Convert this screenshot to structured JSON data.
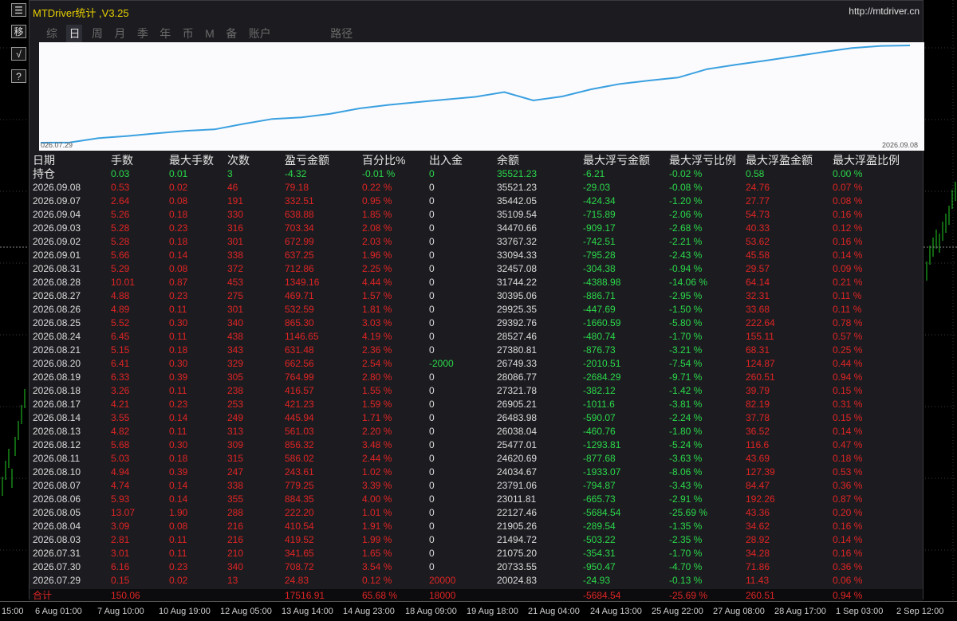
{
  "app": {
    "title": "MTDriver统计 ,V3.25",
    "url": "http://mtdriver.cn",
    "tabs": [
      "综",
      "日",
      "周",
      "月",
      "季",
      "年",
      "币",
      "M",
      "备",
      "账户",
      "路径"
    ],
    "active_tab": "日"
  },
  "side_buttons": [
    "☰",
    "移",
    "√",
    "?"
  ],
  "equity_chart": {
    "start_label": "026.07.29",
    "end_label": "2026.09.08",
    "line_color": "#3aa0e0"
  },
  "table": {
    "headers": [
      "日期",
      "手数",
      "最大手数",
      "次数",
      "盈亏金额",
      "百分比%",
      "出入金",
      "余额",
      "最大浮亏金额",
      "最大浮亏比例",
      "最大浮盈金额",
      "最大浮盈比例"
    ],
    "position_row": [
      "持仓",
      "0.03",
      "0.01",
      "3",
      "-4.32",
      "-0.01 %",
      "0",
      "35521.23",
      "-6.21",
      "-0.02 %",
      "0.58",
      "0.00 %"
    ],
    "rows": [
      [
        "2026.09.08",
        "0.53",
        "0.02",
        "46",
        "79.18",
        "0.22 %",
        "0",
        "35521.23",
        "-29.03",
        "-0.08 %",
        "24.76",
        "0.07 %"
      ],
      [
        "2026.09.07",
        "2.64",
        "0.08",
        "191",
        "332.51",
        "0.95 %",
        "0",
        "35442.05",
        "-424.34",
        "-1.20 %",
        "27.77",
        "0.08 %"
      ],
      [
        "2026.09.04",
        "5.26",
        "0.18",
        "330",
        "638.88",
        "1.85 %",
        "0",
        "35109.54",
        "-715.89",
        "-2.06 %",
        "54.73",
        "0.16 %"
      ],
      [
        "2026.09.03",
        "5.28",
        "0.23",
        "316",
        "703.34",
        "2.08 %",
        "0",
        "34470.66",
        "-909.17",
        "-2.68 %",
        "40.33",
        "0.12 %"
      ],
      [
        "2026.09.02",
        "5.28",
        "0.18",
        "301",
        "672.99",
        "2.03 %",
        "0",
        "33767.32",
        "-742.51",
        "-2.21 %",
        "53.62",
        "0.16 %"
      ],
      [
        "2026.09.01",
        "5.66",
        "0.14",
        "338",
        "637.25",
        "1.96 %",
        "0",
        "33094.33",
        "-795.28",
        "-2.43 %",
        "45.58",
        "0.14 %"
      ],
      [
        "2026.08.31",
        "5.29",
        "0.08",
        "372",
        "712.86",
        "2.25 %",
        "0",
        "32457.08",
        "-304.38",
        "-0.94 %",
        "29.57",
        "0.09 %"
      ],
      [
        "2026.08.28",
        "10.01",
        "0.87",
        "453",
        "1349.16",
        "4.44 %",
        "0",
        "31744.22",
        "-4388.98",
        "-14.06 %",
        "64.14",
        "0.21 %"
      ],
      [
        "2026.08.27",
        "4.88",
        "0.23",
        "275",
        "469.71",
        "1.57 %",
        "0",
        "30395.06",
        "-886.71",
        "-2.95 %",
        "32.31",
        "0.11 %"
      ],
      [
        "2026.08.26",
        "4.89",
        "0.11",
        "301",
        "532.59",
        "1.81 %",
        "0",
        "29925.35",
        "-447.69",
        "-1.50 %",
        "33.68",
        "0.11 %"
      ],
      [
        "2026.08.25",
        "5.52",
        "0.30",
        "340",
        "865.30",
        "3.03 %",
        "0",
        "29392.76",
        "-1660.59",
        "-5.80 %",
        "222.64",
        "0.78 %"
      ],
      [
        "2026.08.24",
        "6.45",
        "0.11",
        "438",
        "1146.65",
        "4.19 %",
        "0",
        "28527.46",
        "-480.74",
        "-1.70 %",
        "155.11",
        "0.57 %"
      ],
      [
        "2026.08.21",
        "5.15",
        "0.18",
        "343",
        "631.48",
        "2.36 %",
        "0",
        "27380.81",
        "-876.73",
        "-3.21 %",
        "68.31",
        "0.25 %"
      ],
      [
        "2026.08.20",
        "6.41",
        "0.30",
        "329",
        "662.56",
        "2.54 %",
        "-2000",
        "26749.33",
        "-2010.51",
        "-7.54 %",
        "124.87",
        "0.44 %"
      ],
      [
        "2026.08.19",
        "6.33",
        "0.39",
        "305",
        "764.99",
        "2.80 %",
        "0",
        "28086.77",
        "-2684.29",
        "-9.71 %",
        "260.51",
        "0.94 %"
      ],
      [
        "2026.08.18",
        "3.26",
        "0.11",
        "238",
        "416.57",
        "1.55 %",
        "0",
        "27321.78",
        "-382.12",
        "-1.42 %",
        "39.79",
        "0.15 %"
      ],
      [
        "2026.08.17",
        "4.21",
        "0.23",
        "253",
        "421.23",
        "1.59 %",
        "0",
        "26905.21",
        "-1011.6",
        "-3.81 %",
        "82.19",
        "0.31 %"
      ],
      [
        "2026.08.14",
        "3.55",
        "0.14",
        "249",
        "445.94",
        "1.71 %",
        "0",
        "26483.98",
        "-590.07",
        "-2.24 %",
        "37.78",
        "0.15 %"
      ],
      [
        "2026.08.13",
        "4.82",
        "0.11",
        "313",
        "561.03",
        "2.20 %",
        "0",
        "26038.04",
        "-460.76",
        "-1.80 %",
        "36.52",
        "0.14 %"
      ],
      [
        "2026.08.12",
        "5.68",
        "0.30",
        "309",
        "856.32",
        "3.48 %",
        "0",
        "25477.01",
        "-1293.81",
        "-5.24 %",
        "116.6",
        "0.47 %"
      ],
      [
        "2026.08.11",
        "5.03",
        "0.18",
        "315",
        "586.02",
        "2.44 %",
        "0",
        "24620.69",
        "-877.68",
        "-3.63 %",
        "43.69",
        "0.18 %"
      ],
      [
        "2026.08.10",
        "4.94",
        "0.39",
        "247",
        "243.61",
        "1.02 %",
        "0",
        "24034.67",
        "-1933.07",
        "-8.06 %",
        "127.39",
        "0.53 %"
      ],
      [
        "2026.08.07",
        "4.74",
        "0.14",
        "338",
        "779.25",
        "3.39 %",
        "0",
        "23791.06",
        "-794.87",
        "-3.43 %",
        "84.47",
        "0.36 %"
      ],
      [
        "2026.08.06",
        "5.93",
        "0.14",
        "355",
        "884.35",
        "4.00 %",
        "0",
        "23011.81",
        "-665.73",
        "-2.91 %",
        "192.26",
        "0.87 %"
      ],
      [
        "2026.08.05",
        "13.07",
        "1.90",
        "288",
        "222.20",
        "1.01 %",
        "0",
        "22127.46",
        "-5684.54",
        "-25.69 %",
        "43.36",
        "0.20 %"
      ],
      [
        "2026.08.04",
        "3.09",
        "0.08",
        "216",
        "410.54",
        "1.91 %",
        "0",
        "21905.26",
        "-289.54",
        "-1.35 %",
        "34.62",
        "0.16 %"
      ],
      [
        "2026.08.03",
        "2.81",
        "0.11",
        "216",
        "419.52",
        "1.99 %",
        "0",
        "21494.72",
        "-503.22",
        "-2.35 %",
        "28.92",
        "0.14 %"
      ],
      [
        "2026.07.31",
        "3.01",
        "0.11",
        "210",
        "341.65",
        "1.65 %",
        "0",
        "21075.20",
        "-354.31",
        "-1.70 %",
        "34.28",
        "0.16 %"
      ],
      [
        "2026.07.30",
        "6.16",
        "0.23",
        "340",
        "708.72",
        "3.54 %",
        "0",
        "20733.55",
        "-950.47",
        "-4.70 %",
        "71.86",
        "0.36 %"
      ],
      [
        "2026.07.29",
        "0.15",
        "0.02",
        "13",
        "24.83",
        "0.12 %",
        "20000",
        "20024.83",
        "-24.93",
        "-0.13 %",
        "11.43",
        "0.06 %"
      ]
    ],
    "total_row": [
      "合计",
      "150.06",
      "",
      "",
      "17516.91",
      "65.68 %",
      "18000",
      "",
      "-5684.54",
      "-25.69 %",
      "260.51",
      "0.94 %"
    ]
  },
  "time_axis": [
    "15:00",
    "6 Aug 01:00",
    "7 Aug 10:00",
    "10 Aug 19:00",
    "12 Aug 05:00",
    "13 Aug 14:00",
    "14 Aug 23:00",
    "18 Aug 09:00",
    "19 Aug 18:00",
    "21 Aug 04:00",
    "24 Aug 13:00",
    "25 Aug 22:00",
    "27 Aug 08:00",
    "28 Aug 17:00",
    "1 Sep 03:00",
    "2 Sep 12:00"
  ],
  "colors": {
    "positive": "#e02424",
    "negative": "#2bd84a",
    "candle": "#22cc22"
  }
}
